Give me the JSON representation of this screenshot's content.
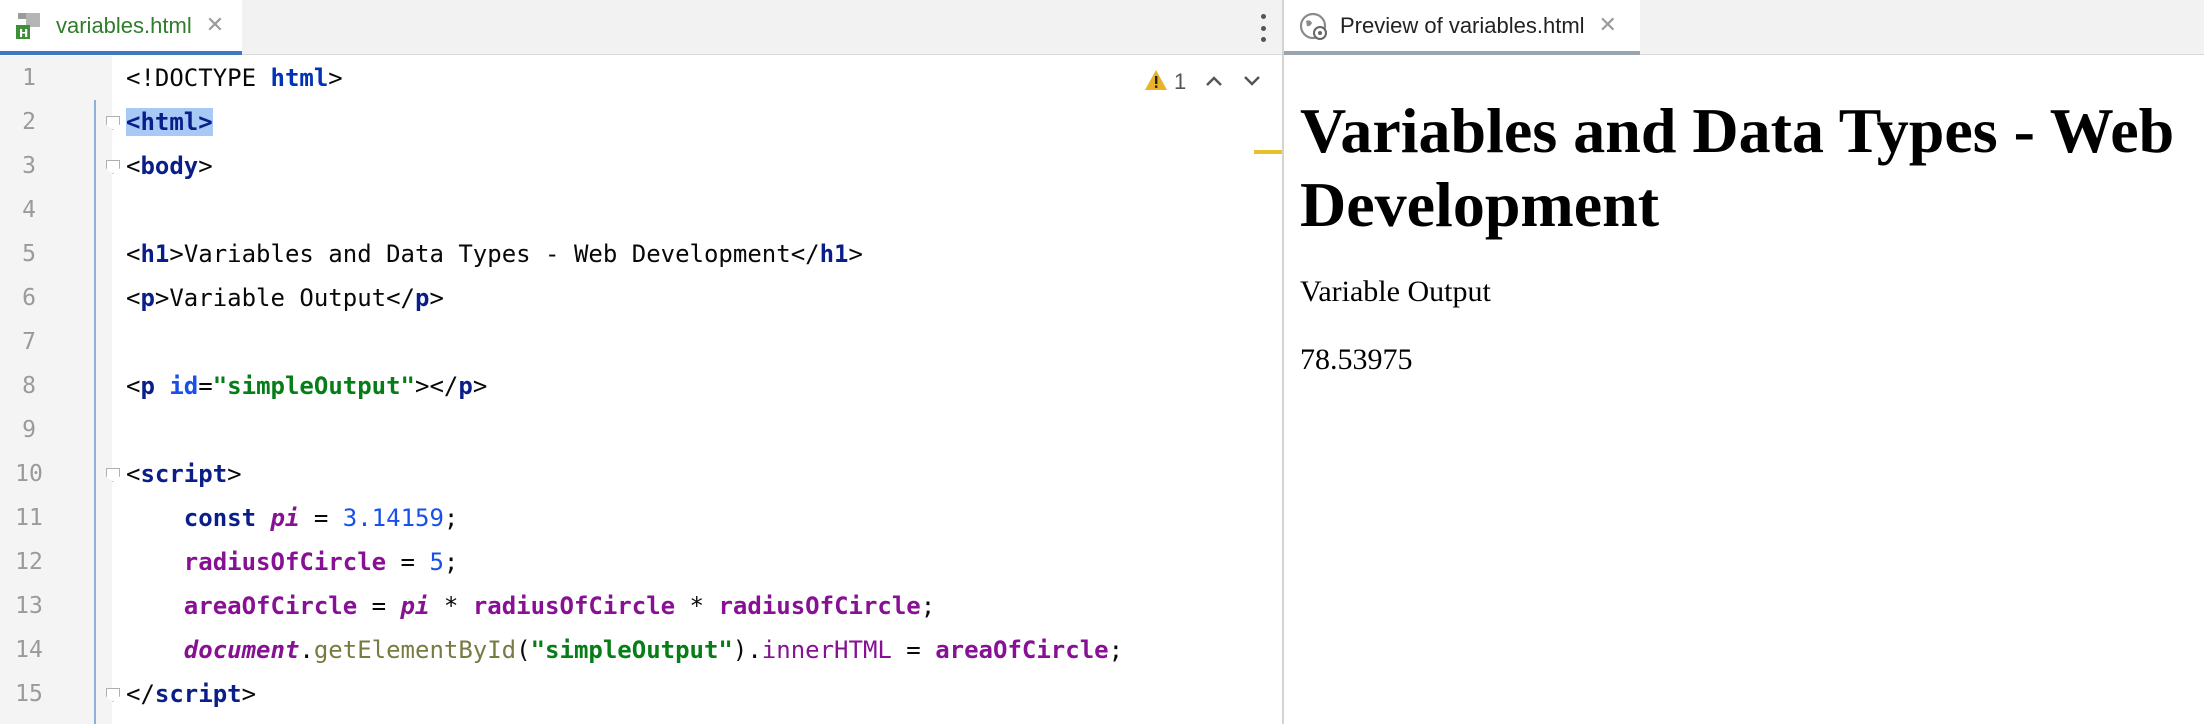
{
  "editor": {
    "tab": {
      "label": "variables.html",
      "icon": "html-file-icon"
    },
    "inspections": {
      "warning_count": "1"
    },
    "line_numbers": [
      "1",
      "2",
      "3",
      "4",
      "5",
      "6",
      "7",
      "8",
      "9",
      "10",
      "11",
      "12",
      "13",
      "14",
      "15"
    ],
    "code": {
      "l1": {
        "open": "<!DOCTYPE ",
        "kw": "html",
        "close": ">"
      },
      "l2": {
        "text": "<html>"
      },
      "l3": {
        "lt": "<",
        "tag": "body",
        "gt": ">"
      },
      "l5": {
        "lt": "<",
        "tag": "h1",
        "gt": ">",
        "content": "Variables and Data Types - Web Development",
        "clt": "</",
        "ctag": "h1",
        "cgt": ">"
      },
      "l6": {
        "lt": "<",
        "tag": "p",
        "gt": ">",
        "content": "Variable Output",
        "clt": "</",
        "ctag": "p",
        "cgt": ">"
      },
      "l8": {
        "lt": "<",
        "tag": "p",
        "sp": " ",
        "attr": "id",
        "eq": "=",
        "val": "\"simpleOutput\"",
        "gt": ">",
        "clt": "</",
        "ctag": "p",
        "cgt": ">"
      },
      "l10": {
        "lt": "<",
        "tag": "script",
        "gt": ">"
      },
      "l11": {
        "indent": "    ",
        "kw": "const",
        "sp": " ",
        "var": "pi",
        "op": " = ",
        "num": "3.14159",
        "semi": ";"
      },
      "l12": {
        "indent": "    ",
        "var": "radiusOfCircle",
        "op": " = ",
        "num": "5",
        "semi": ";"
      },
      "l13": {
        "indent": "    ",
        "var1": "areaOfCircle",
        "op1": " = ",
        "var2": "pi",
        "op2": " * ",
        "var3": "radiusOfCircle",
        "op3": " * ",
        "var4": "radiusOfCircle",
        "semi": ";"
      },
      "l14": {
        "indent": "    ",
        "obj": "document",
        "dot1": ".",
        "method": "getElementById",
        "p1": "(",
        "str": "\"simpleOutput\"",
        "p2": ")",
        "dot2": ".",
        "prop": "innerHTML",
        "op": " = ",
        "var": "areaOfCircle",
        "semi": ";"
      },
      "l15": {
        "lt": "</",
        "tag": "script",
        "gt": ">"
      }
    }
  },
  "preview": {
    "tab": {
      "label": "Preview of variables.html",
      "icon": "browser-preview-icon"
    },
    "h1": "Variables and Data Types - Web Development",
    "p1": "Variable Output",
    "output": "78.53975"
  },
  "colors": {
    "tag": "#0a1e8a",
    "string": "#067d17",
    "number": "#1750eb",
    "variable": "#871094",
    "method": "#7a7a43",
    "selection": "#a6c9f5",
    "active_tab_underline": "#3b79c3",
    "warning": "#e8c12a"
  }
}
